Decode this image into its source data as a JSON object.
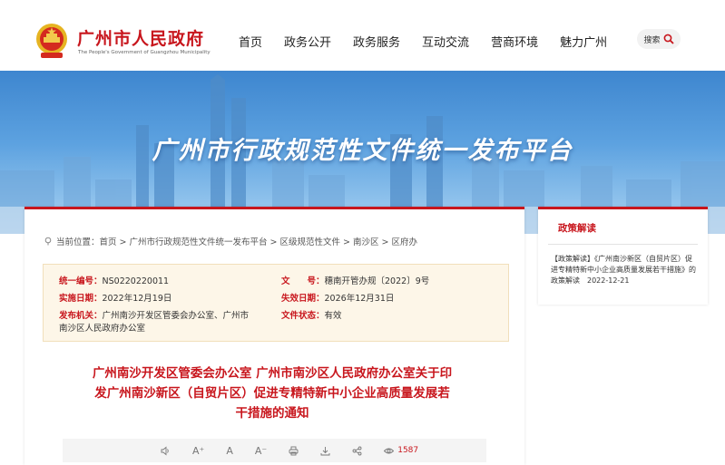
{
  "header": {
    "logo_cn": "广州市人民政府",
    "logo_en": "The People's Government of Guangzhou Municipality",
    "nav": [
      "首页",
      "政务公开",
      "政务服务",
      "互动交流",
      "营商环境",
      "魅力广州"
    ],
    "search_label": "搜索",
    "emblem_icon": "national-emblem-icon",
    "search_icon": "magnifier-icon"
  },
  "banner": {
    "title": "广州市行政规范性文件统一发布平台"
  },
  "breadcrumb": {
    "text": "当前位置：首页 > 广州市行政规范性文件统一发布平台 > 区级规范性文件 > 南沙区 > 区府办"
  },
  "info": {
    "code_label": "统一编号：",
    "code_value": "NS0220220011",
    "docno_label": "文　　号：",
    "docno_value": "穗南开管办规〔2022〕9号",
    "impl_label": "实施日期：",
    "impl_value": "2022年12月19日",
    "expire_label": "失效日期：",
    "expire_value": "2026年12月31日",
    "issuer_label": "发布机关：",
    "issuer_value_1": "广州南沙开发区管委会办公室、广州市",
    "issuer_value_2": "南沙区人民政府办公室",
    "status_label": "文件状态：",
    "status_value": "有效"
  },
  "doc": {
    "title_1": "广州南沙开发区管委会办公室 广州市南沙区人民政府办公室关于印",
    "title_2": "发广州南沙新区（自贸片区）促进专精特新中小企业高质量发展若",
    "title_3": "干措施的通知"
  },
  "toolbar": {
    "font_larger": "A⁺",
    "font_normal": "A",
    "font_smaller": "A⁻",
    "views": "1587"
  },
  "sidebar": {
    "title": "政策解读",
    "text": "【政策解读】《广州南沙新区（自贸片区）促进专精特新中小企业高质量发展若干措施》的政策解读　2022-12-21"
  },
  "colors": {
    "brand_red": "#c8161d",
    "info_bg": "#fdf6e8",
    "banner_blue": "#3e86cf"
  }
}
